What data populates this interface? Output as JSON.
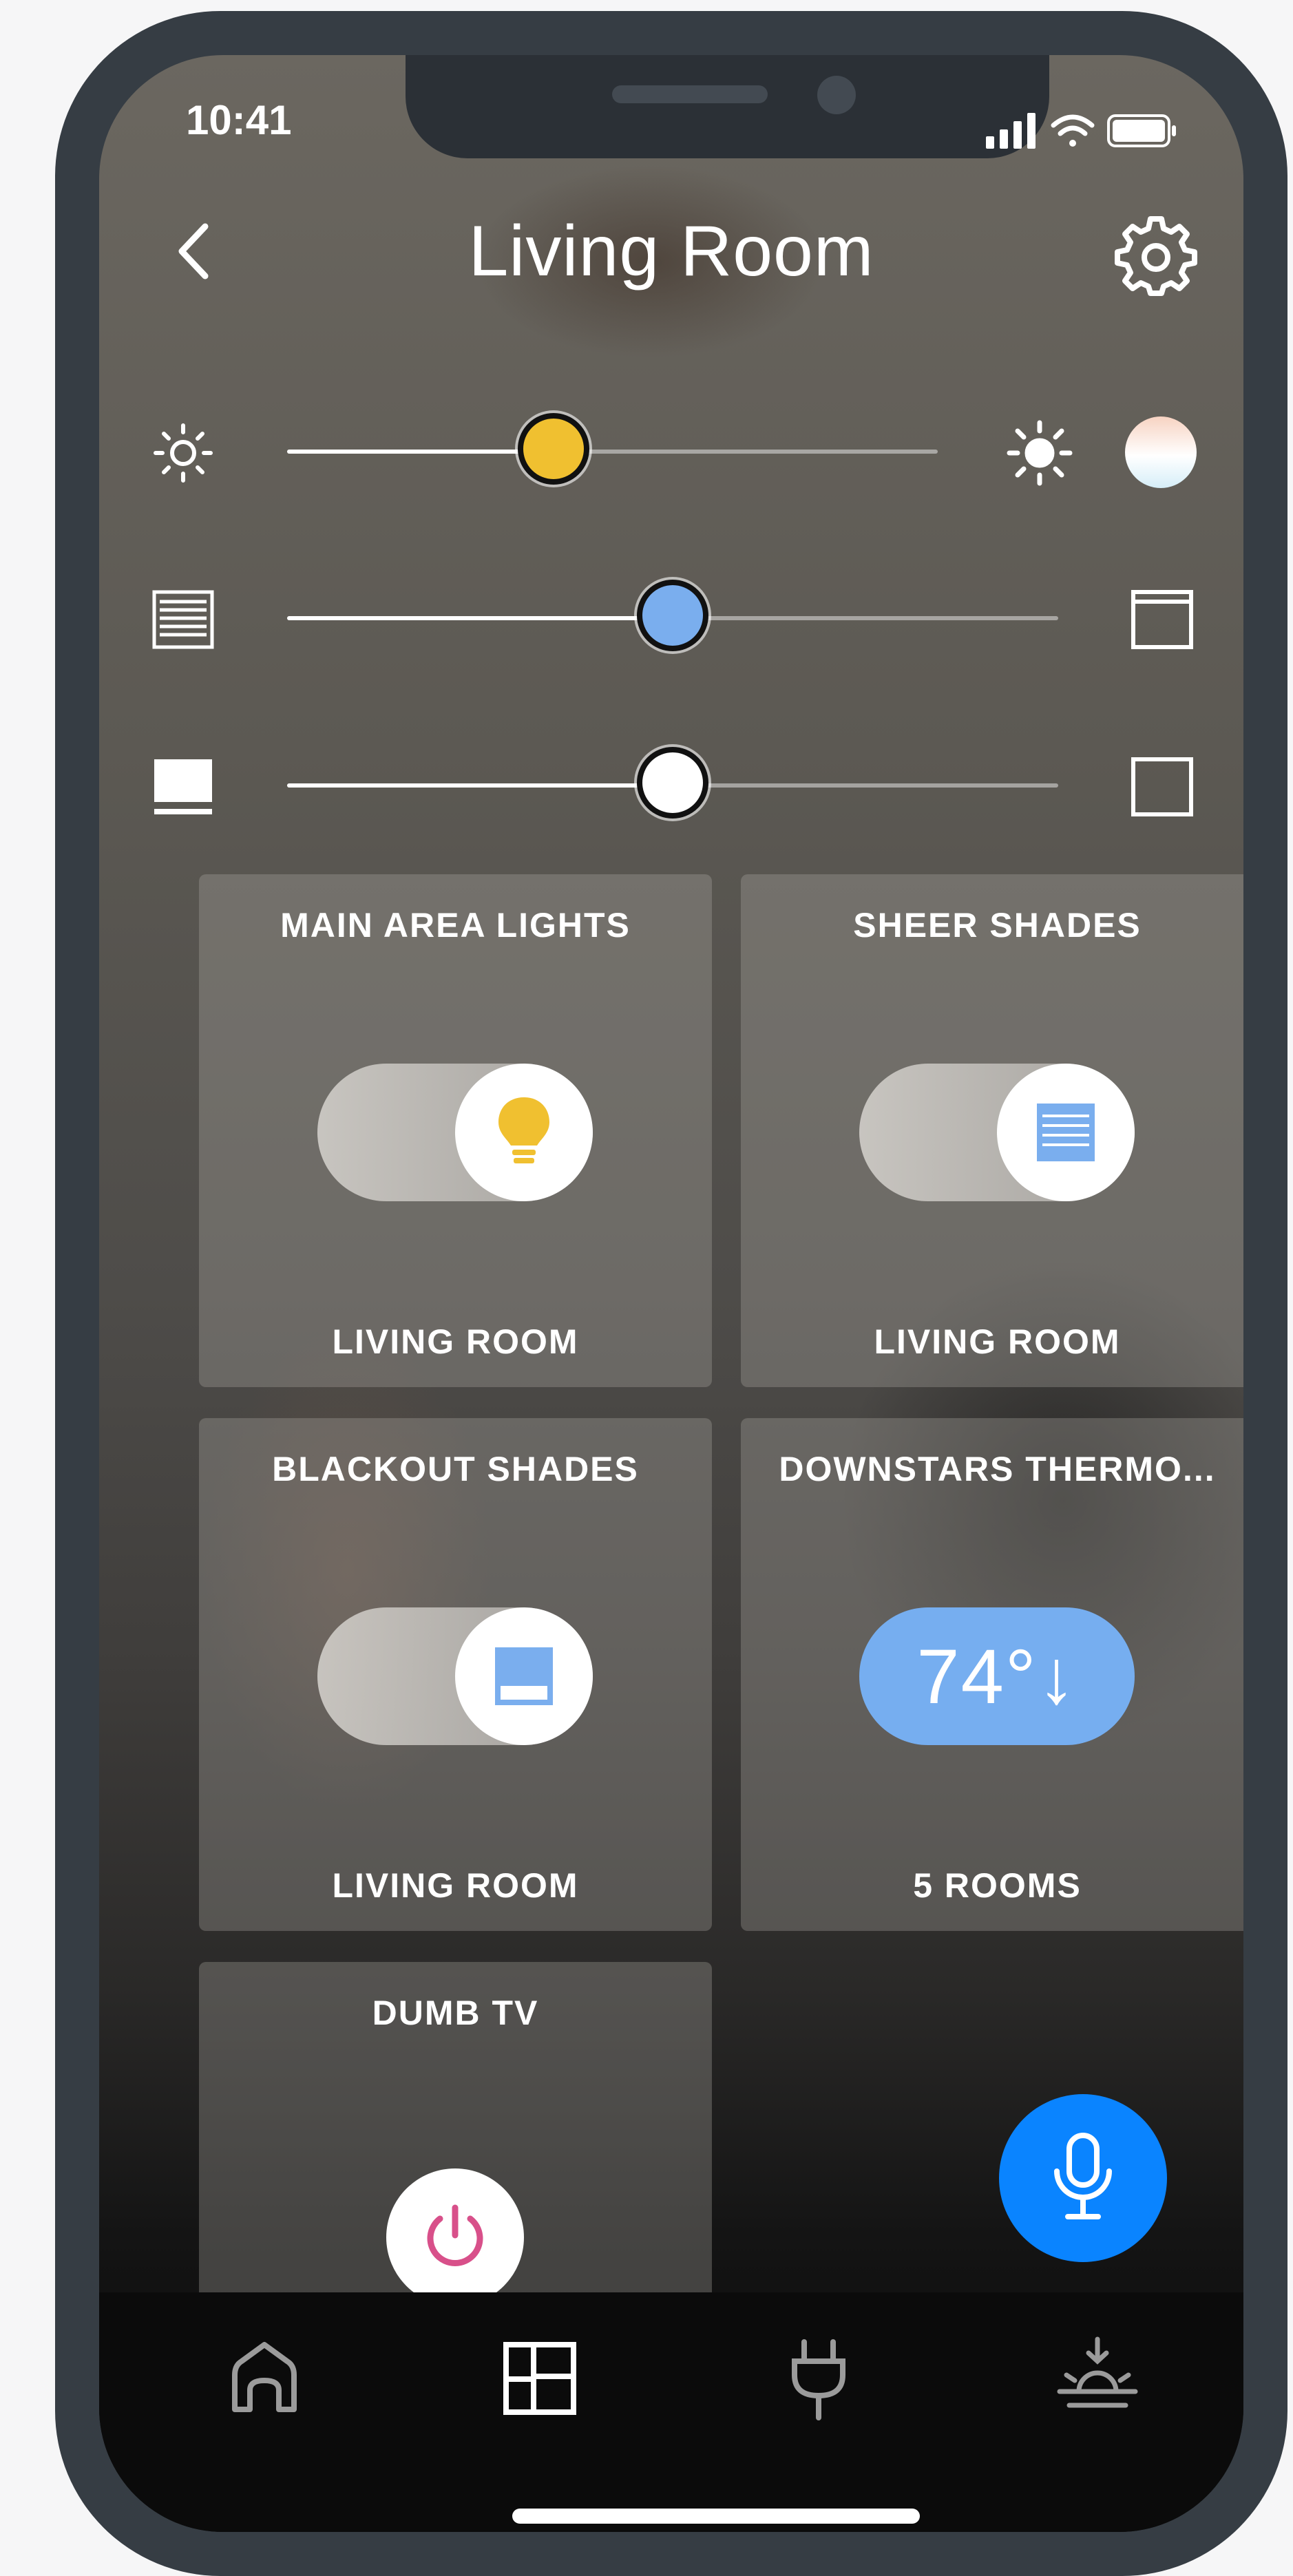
{
  "status_bar": {
    "time": "10:41"
  },
  "header": {
    "title": "Living Room"
  },
  "sliders": {
    "brightness": {
      "value_pct": 41
    },
    "sheer_shades": {
      "value_pct": 50
    },
    "blackout_shades": {
      "value_pct": 50
    }
  },
  "tiles": {
    "main_lights": {
      "title": "MAIN AREA LIGHTS",
      "subtitle": "LIVING ROOM"
    },
    "sheer_shades": {
      "title": "SHEER SHADES",
      "subtitle": "LIVING ROOM"
    },
    "blackout_shades": {
      "title": "BLACKOUT SHADES",
      "subtitle": "LIVING ROOM"
    },
    "thermostat": {
      "title": "DOWNSTARS THERMO...",
      "temperature": "74°↓",
      "subtitle": "5 ROOMS"
    },
    "tv": {
      "title": "DUMB TV"
    }
  },
  "colors": {
    "light_yellow": "#f0c030",
    "shade_blue": "#7aaeee",
    "mic_blue": "#0a84ff",
    "power_pink": "#d8508a",
    "frame": "#363d44"
  },
  "icons": {
    "back": "chevron-left-icon",
    "settings": "gear-icon",
    "dim_sun": "sun-dim-icon",
    "bright_sun": "sun-bright-icon",
    "shade_closed": "shade-closed-icon",
    "shade_open": "window-open-icon",
    "bulb": "lightbulb-icon",
    "power": "power-icon",
    "mic": "microphone-icon",
    "tab_home": "home-icon",
    "tab_rooms": "rooms-icon",
    "tab_devices": "plug-icon",
    "tab_scenes": "sunrise-icon"
  },
  "tabbar": {
    "active": "rooms"
  }
}
